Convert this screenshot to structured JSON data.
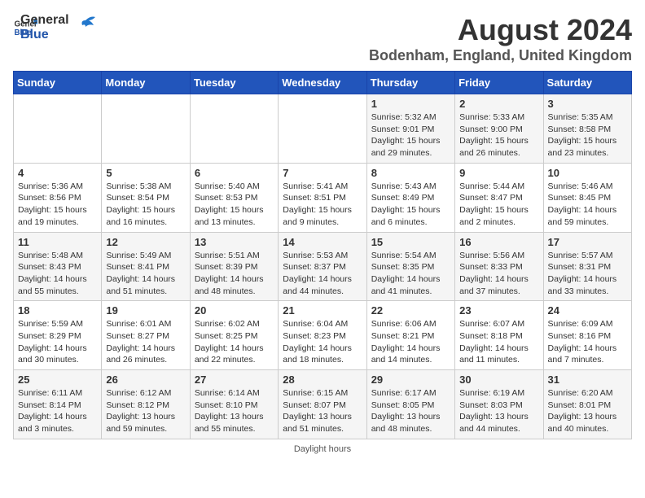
{
  "header": {
    "logo_general": "General",
    "logo_blue": "Blue",
    "month_year": "August 2024",
    "location": "Bodenham, England, United Kingdom"
  },
  "days_of_week": [
    "Sunday",
    "Monday",
    "Tuesday",
    "Wednesday",
    "Thursday",
    "Friday",
    "Saturday"
  ],
  "weeks": [
    [
      {
        "day": "",
        "detail": ""
      },
      {
        "day": "",
        "detail": ""
      },
      {
        "day": "",
        "detail": ""
      },
      {
        "day": "",
        "detail": ""
      },
      {
        "day": "1",
        "detail": "Sunrise: 5:32 AM\nSunset: 9:01 PM\nDaylight: 15 hours\nand 29 minutes."
      },
      {
        "day": "2",
        "detail": "Sunrise: 5:33 AM\nSunset: 9:00 PM\nDaylight: 15 hours\nand 26 minutes."
      },
      {
        "day": "3",
        "detail": "Sunrise: 5:35 AM\nSunset: 8:58 PM\nDaylight: 15 hours\nand 23 minutes."
      }
    ],
    [
      {
        "day": "4",
        "detail": "Sunrise: 5:36 AM\nSunset: 8:56 PM\nDaylight: 15 hours\nand 19 minutes."
      },
      {
        "day": "5",
        "detail": "Sunrise: 5:38 AM\nSunset: 8:54 PM\nDaylight: 15 hours\nand 16 minutes."
      },
      {
        "day": "6",
        "detail": "Sunrise: 5:40 AM\nSunset: 8:53 PM\nDaylight: 15 hours\nand 13 minutes."
      },
      {
        "day": "7",
        "detail": "Sunrise: 5:41 AM\nSunset: 8:51 PM\nDaylight: 15 hours\nand 9 minutes."
      },
      {
        "day": "8",
        "detail": "Sunrise: 5:43 AM\nSunset: 8:49 PM\nDaylight: 15 hours\nand 6 minutes."
      },
      {
        "day": "9",
        "detail": "Sunrise: 5:44 AM\nSunset: 8:47 PM\nDaylight: 15 hours\nand 2 minutes."
      },
      {
        "day": "10",
        "detail": "Sunrise: 5:46 AM\nSunset: 8:45 PM\nDaylight: 14 hours\nand 59 minutes."
      }
    ],
    [
      {
        "day": "11",
        "detail": "Sunrise: 5:48 AM\nSunset: 8:43 PM\nDaylight: 14 hours\nand 55 minutes."
      },
      {
        "day": "12",
        "detail": "Sunrise: 5:49 AM\nSunset: 8:41 PM\nDaylight: 14 hours\nand 51 minutes."
      },
      {
        "day": "13",
        "detail": "Sunrise: 5:51 AM\nSunset: 8:39 PM\nDaylight: 14 hours\nand 48 minutes."
      },
      {
        "day": "14",
        "detail": "Sunrise: 5:53 AM\nSunset: 8:37 PM\nDaylight: 14 hours\nand 44 minutes."
      },
      {
        "day": "15",
        "detail": "Sunrise: 5:54 AM\nSunset: 8:35 PM\nDaylight: 14 hours\nand 41 minutes."
      },
      {
        "day": "16",
        "detail": "Sunrise: 5:56 AM\nSunset: 8:33 PM\nDaylight: 14 hours\nand 37 minutes."
      },
      {
        "day": "17",
        "detail": "Sunrise: 5:57 AM\nSunset: 8:31 PM\nDaylight: 14 hours\nand 33 minutes."
      }
    ],
    [
      {
        "day": "18",
        "detail": "Sunrise: 5:59 AM\nSunset: 8:29 PM\nDaylight: 14 hours\nand 30 minutes."
      },
      {
        "day": "19",
        "detail": "Sunrise: 6:01 AM\nSunset: 8:27 PM\nDaylight: 14 hours\nand 26 minutes."
      },
      {
        "day": "20",
        "detail": "Sunrise: 6:02 AM\nSunset: 8:25 PM\nDaylight: 14 hours\nand 22 minutes."
      },
      {
        "day": "21",
        "detail": "Sunrise: 6:04 AM\nSunset: 8:23 PM\nDaylight: 14 hours\nand 18 minutes."
      },
      {
        "day": "22",
        "detail": "Sunrise: 6:06 AM\nSunset: 8:21 PM\nDaylight: 14 hours\nand 14 minutes."
      },
      {
        "day": "23",
        "detail": "Sunrise: 6:07 AM\nSunset: 8:18 PM\nDaylight: 14 hours\nand 11 minutes."
      },
      {
        "day": "24",
        "detail": "Sunrise: 6:09 AM\nSunset: 8:16 PM\nDaylight: 14 hours\nand 7 minutes."
      }
    ],
    [
      {
        "day": "25",
        "detail": "Sunrise: 6:11 AM\nSunset: 8:14 PM\nDaylight: 14 hours\nand 3 minutes."
      },
      {
        "day": "26",
        "detail": "Sunrise: 6:12 AM\nSunset: 8:12 PM\nDaylight: 13 hours\nand 59 minutes."
      },
      {
        "day": "27",
        "detail": "Sunrise: 6:14 AM\nSunset: 8:10 PM\nDaylight: 13 hours\nand 55 minutes."
      },
      {
        "day": "28",
        "detail": "Sunrise: 6:15 AM\nSunset: 8:07 PM\nDaylight: 13 hours\nand 51 minutes."
      },
      {
        "day": "29",
        "detail": "Sunrise: 6:17 AM\nSunset: 8:05 PM\nDaylight: 13 hours\nand 48 minutes."
      },
      {
        "day": "30",
        "detail": "Sunrise: 6:19 AM\nSunset: 8:03 PM\nDaylight: 13 hours\nand 44 minutes."
      },
      {
        "day": "31",
        "detail": "Sunrise: 6:20 AM\nSunset: 8:01 PM\nDaylight: 13 hours\nand 40 minutes."
      }
    ]
  ],
  "footer": {
    "note": "Daylight hours"
  }
}
